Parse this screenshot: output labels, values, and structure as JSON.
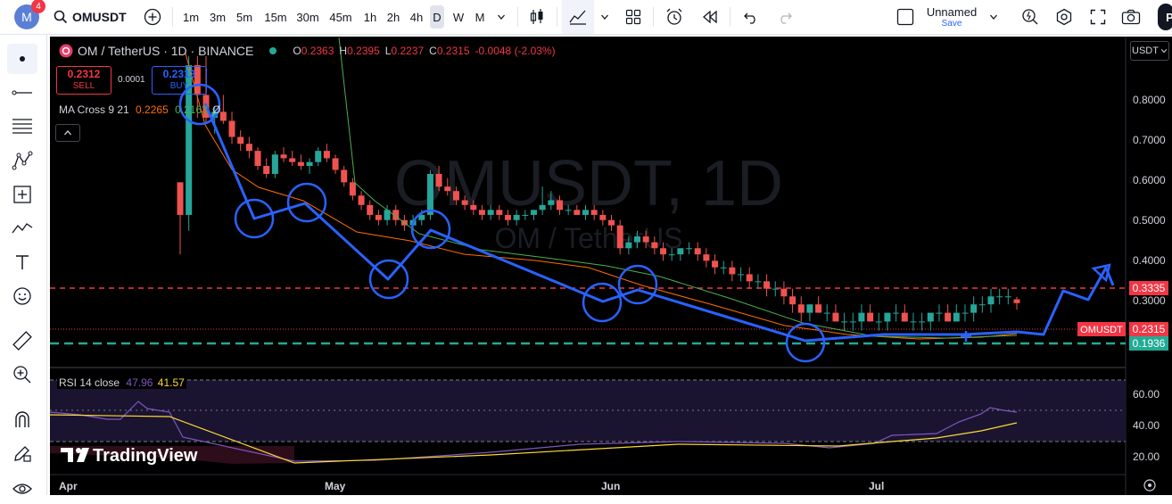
{
  "app": {
    "badge_count": "4",
    "avatar_letter": "M"
  },
  "toolbar": {
    "symbol": "OMUSDT",
    "timeframes": [
      "1m",
      "3m",
      "5m",
      "15m",
      "30m",
      "45m",
      "1h",
      "2h",
      "4h",
      "D",
      "W",
      "M"
    ],
    "active_timeframe": "D",
    "layout_name": "Unnamed",
    "save_label": "Save",
    "publish_label": "P"
  },
  "legend": {
    "title": "OM / TetherUS · 1D · BINANCE",
    "open_label": "O",
    "open": "0.2363",
    "high_label": "H",
    "high": "0.2395",
    "low_label": "L",
    "low": "0.2237",
    "close_label": "C",
    "close": "0.2315",
    "change": "-0.0048 (-2.03%)",
    "sell_price": "0.2312",
    "sell_label": "SELL",
    "spread": "0.0001",
    "buy_price": "0.2313",
    "buy_label": "BUY",
    "ma_label": "MA Cross 9 21",
    "ma_fast": "0.2265",
    "ma_slow": "0.2163",
    "ma_extra": "Ø"
  },
  "watermark": {
    "symbol": "OMUSDT, 1D",
    "name": "OM / TetherUS"
  },
  "currency": "USDT",
  "price_axis": [
    "0.8000",
    "0.7000",
    "0.6000",
    "0.5000",
    "0.4000",
    "0.3000"
  ],
  "price_tags": {
    "red_line": "0.3335",
    "last_symbol": "OMUSDT",
    "last_price": "0.2315",
    "green_line": "0.1936"
  },
  "rsi": {
    "label": "RSI 14 close",
    "value": "47.96",
    "ma": "41.57",
    "axis": [
      "60.00",
      "40.00",
      "20.00"
    ]
  },
  "time_axis": [
    "Apr",
    "May",
    "Jun",
    "Jul"
  ],
  "brand": "TradingView",
  "colors": {
    "up": "#26a69a",
    "down": "#ef5350",
    "annotation": "#2962ff",
    "resistance": "#f23645",
    "support": "#22ab94",
    "ma_fast": "#ff6d00",
    "ma_slow": "#4caf50",
    "rsi": "#7e57c2",
    "rsi_ma": "#fdd835"
  },
  "chart_data": {
    "type": "candlestick",
    "y_scale": "log",
    "y_range": [
      0.17,
      0.95
    ],
    "candles": [
      [
        0.44,
        0.44,
        0.3,
        0.37
      ],
      [
        0.37,
        0.86,
        0.34,
        0.82
      ],
      [
        0.82,
        0.86,
        0.62,
        0.7
      ],
      [
        0.7,
        0.86,
        0.6,
        0.62
      ],
      [
        0.62,
        0.66,
        0.57,
        0.64
      ],
      [
        0.64,
        0.7,
        0.6,
        0.61
      ],
      [
        0.61,
        0.64,
        0.54,
        0.56
      ],
      [
        0.56,
        0.58,
        0.52,
        0.54
      ],
      [
        0.54,
        0.56,
        0.5,
        0.52
      ],
      [
        0.52,
        0.53,
        0.47,
        0.48
      ],
      [
        0.48,
        0.5,
        0.45,
        0.46
      ],
      [
        0.46,
        0.52,
        0.45,
        0.51
      ],
      [
        0.51,
        0.53,
        0.49,
        0.5
      ],
      [
        0.5,
        0.52,
        0.48,
        0.49
      ],
      [
        0.49,
        0.51,
        0.47,
        0.48
      ],
      [
        0.48,
        0.5,
        0.46,
        0.49
      ],
      [
        0.49,
        0.53,
        0.48,
        0.52
      ],
      [
        0.52,
        0.54,
        0.49,
        0.5
      ],
      [
        0.5,
        0.51,
        0.46,
        0.47
      ],
      [
        0.47,
        0.48,
        0.43,
        0.44
      ],
      [
        0.44,
        0.45,
        0.4,
        0.41
      ],
      [
        0.41,
        0.42,
        0.38,
        0.39
      ],
      [
        0.39,
        0.4,
        0.36,
        0.37
      ],
      [
        0.37,
        0.38,
        0.35,
        0.36
      ],
      [
        0.36,
        0.39,
        0.35,
        0.38
      ],
      [
        0.38,
        0.39,
        0.35,
        0.36
      ],
      [
        0.36,
        0.37,
        0.34,
        0.35
      ],
      [
        0.35,
        0.37,
        0.34,
        0.36
      ],
      [
        0.36,
        0.38,
        0.35,
        0.37
      ],
      [
        0.37,
        0.47,
        0.36,
        0.46
      ],
      [
        0.46,
        0.48,
        0.42,
        0.43
      ],
      [
        0.43,
        0.45,
        0.41,
        0.42
      ],
      [
        0.42,
        0.43,
        0.39,
        0.4
      ],
      [
        0.4,
        0.41,
        0.38,
        0.39
      ],
      [
        0.39,
        0.4,
        0.37,
        0.38
      ],
      [
        0.38,
        0.39,
        0.36,
        0.37
      ],
      [
        0.37,
        0.39,
        0.36,
        0.38
      ],
      [
        0.38,
        0.39,
        0.36,
        0.37
      ],
      [
        0.37,
        0.38,
        0.35,
        0.36
      ],
      [
        0.36,
        0.38,
        0.35,
        0.37
      ],
      [
        0.37,
        0.38,
        0.36,
        0.37
      ],
      [
        0.37,
        0.38,
        0.36,
        0.38
      ],
      [
        0.38,
        0.43,
        0.37,
        0.39
      ],
      [
        0.39,
        0.42,
        0.38,
        0.4
      ],
      [
        0.4,
        0.41,
        0.37,
        0.38
      ],
      [
        0.38,
        0.39,
        0.37,
        0.38
      ],
      [
        0.38,
        0.39,
        0.37,
        0.37
      ],
      [
        0.37,
        0.39,
        0.36,
        0.38
      ],
      [
        0.38,
        0.39,
        0.36,
        0.37
      ],
      [
        0.37,
        0.38,
        0.35,
        0.36
      ],
      [
        0.36,
        0.37,
        0.34,
        0.35
      ],
      [
        0.35,
        0.36,
        0.3,
        0.31
      ],
      [
        0.31,
        0.33,
        0.3,
        0.32
      ],
      [
        0.32,
        0.34,
        0.31,
        0.33
      ],
      [
        0.33,
        0.34,
        0.31,
        0.32
      ],
      [
        0.32,
        0.33,
        0.3,
        0.31
      ],
      [
        0.31,
        0.32,
        0.29,
        0.3
      ],
      [
        0.3,
        0.31,
        0.29,
        0.3
      ],
      [
        0.3,
        0.31,
        0.29,
        0.31
      ],
      [
        0.31,
        0.32,
        0.3,
        0.31
      ],
      [
        0.31,
        0.32,
        0.29,
        0.3
      ],
      [
        0.3,
        0.31,
        0.28,
        0.29
      ],
      [
        0.29,
        0.3,
        0.27,
        0.28
      ],
      [
        0.28,
        0.29,
        0.27,
        0.28
      ],
      [
        0.28,
        0.29,
        0.26,
        0.27
      ],
      [
        0.27,
        0.28,
        0.26,
        0.27
      ],
      [
        0.27,
        0.28,
        0.25,
        0.26
      ],
      [
        0.26,
        0.27,
        0.25,
        0.26
      ],
      [
        0.26,
        0.27,
        0.24,
        0.25
      ],
      [
        0.25,
        0.26,
        0.24,
        0.25
      ],
      [
        0.25,
        0.26,
        0.23,
        0.24
      ],
      [
        0.24,
        0.25,
        0.22,
        0.23
      ],
      [
        0.23,
        0.24,
        0.21,
        0.22
      ],
      [
        0.22,
        0.23,
        0.21,
        0.23
      ],
      [
        0.23,
        0.24,
        0.22,
        0.22
      ],
      [
        0.22,
        0.23,
        0.21,
        0.22
      ],
      [
        0.22,
        0.23,
        0.21,
        0.21
      ],
      [
        0.21,
        0.22,
        0.2,
        0.21
      ],
      [
        0.21,
        0.22,
        0.2,
        0.21
      ],
      [
        0.21,
        0.23,
        0.2,
        0.22
      ],
      [
        0.22,
        0.23,
        0.21,
        0.21
      ],
      [
        0.21,
        0.22,
        0.2,
        0.21
      ],
      [
        0.21,
        0.22,
        0.2,
        0.22
      ],
      [
        0.22,
        0.23,
        0.21,
        0.22
      ],
      [
        0.22,
        0.23,
        0.21,
        0.21
      ],
      [
        0.21,
        0.22,
        0.2,
        0.21
      ],
      [
        0.21,
        0.22,
        0.2,
        0.21
      ],
      [
        0.21,
        0.22,
        0.2,
        0.22
      ],
      [
        0.22,
        0.23,
        0.21,
        0.22
      ],
      [
        0.22,
        0.23,
        0.21,
        0.21
      ],
      [
        0.21,
        0.23,
        0.21,
        0.22
      ],
      [
        0.22,
        0.23,
        0.21,
        0.22
      ],
      [
        0.22,
        0.24,
        0.21,
        0.23
      ],
      [
        0.23,
        0.24,
        0.22,
        0.23
      ],
      [
        0.23,
        0.25,
        0.22,
        0.24
      ],
      [
        0.24,
        0.25,
        0.23,
        0.24
      ],
      [
        0.24,
        0.25,
        0.23,
        0.24
      ],
      [
        0.2363,
        0.2395,
        0.2237,
        0.2315
      ]
    ]
  }
}
